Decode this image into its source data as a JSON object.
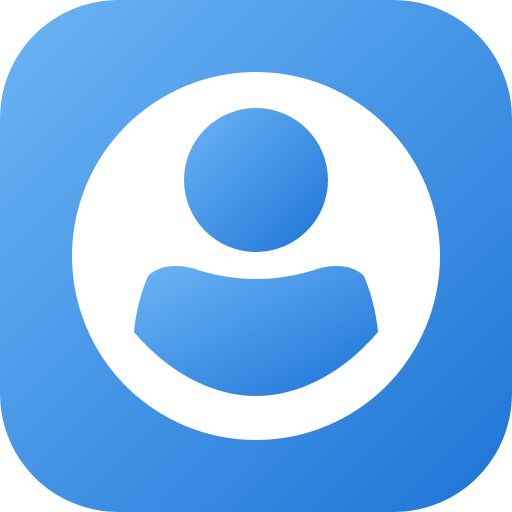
{
  "icon": {
    "name": "user-profile-icon",
    "colors": {
      "gradient_start": "#6BB4F5",
      "gradient_end": "#1E74D6",
      "foreground": "#FFFFFF"
    }
  }
}
